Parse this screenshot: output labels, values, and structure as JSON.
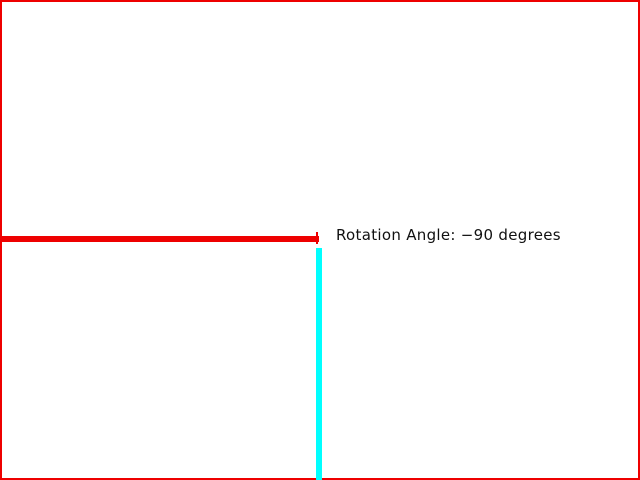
{
  "colors": {
    "frame": "#ee0000",
    "rotated_line": "#ee0000",
    "reference_line": "#00ffff",
    "text": "#111111",
    "background": "#ffffff"
  },
  "annotation": {
    "label": "Rotation Angle: −90 degrees"
  }
}
